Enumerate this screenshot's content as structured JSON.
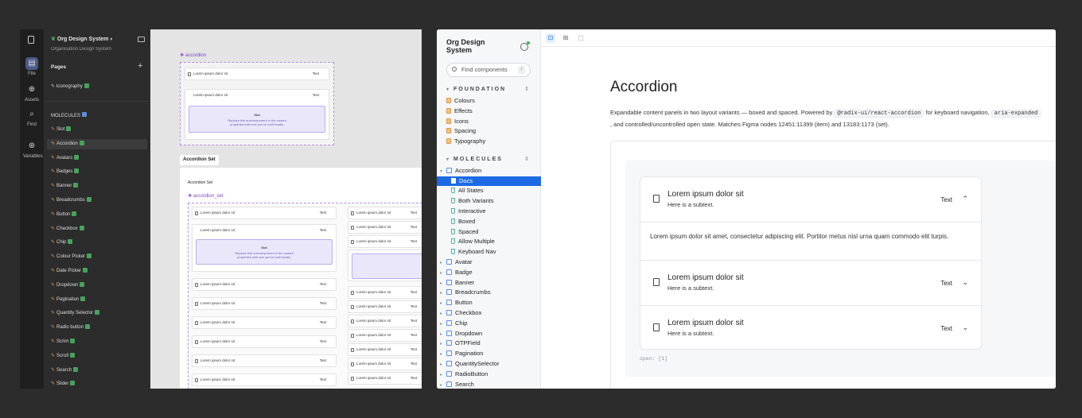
{
  "figma": {
    "rail": [
      {
        "label": "File",
        "icon": "file-icon"
      },
      {
        "label": "Assets",
        "icon": "assets-icon"
      },
      {
        "label": "Find",
        "icon": "search-icon"
      },
      {
        "label": "Variables",
        "icon": "variables-icon"
      }
    ],
    "project_title": "Org Design System",
    "project_subtitle": "Organisation Design System",
    "pages_label": "Pages",
    "pages": [
      {
        "label": "Iconography"
      }
    ],
    "molecules_header": "MOLECULES",
    "layers": [
      {
        "label": "Slot"
      },
      {
        "label": "Accordion"
      },
      {
        "label": "Avatars"
      },
      {
        "label": "Badges"
      },
      {
        "label": "Banner"
      },
      {
        "label": "Breadcrumbs"
      },
      {
        "label": "Button"
      },
      {
        "label": "Checkbox"
      },
      {
        "label": "Chip"
      },
      {
        "label": "Colour Picker"
      },
      {
        "label": "Date Picker"
      },
      {
        "label": "Dropdown"
      },
      {
        "label": "Pagination"
      },
      {
        "label": "Quantity Selector"
      },
      {
        "label": "Radio button"
      },
      {
        "label": "Scrim"
      },
      {
        "label": "Scroll"
      },
      {
        "label": "Search"
      },
      {
        "label": "Slider"
      }
    ],
    "canvas": {
      "accordion_frame_label": "accordion",
      "accordion_set_tab": "Accordion Set",
      "accordion_set_title": "Accordion Set",
      "accordion_set_frame_label": "accordion_set",
      "row_title": "Lorem ipsum dolor sit",
      "row_text": "Text",
      "slot_title": "Slot",
      "slot_desc": "Replace this subcomponent in the variant properties with one you've built locally."
    }
  },
  "storybook": {
    "title": "Org Design System",
    "search_placeholder": "Find components",
    "search_shortcut": "/",
    "foundation_header": "FOUNDATION",
    "foundation_items": [
      "Colours",
      "Effects",
      "Icons",
      "Spacing",
      "Typography"
    ],
    "molecules_header": "MOLECULES",
    "accordion_label": "Accordion",
    "accordion_stories": [
      "Docs",
      "All States",
      "Both Variants",
      "Interactive",
      "Boxed",
      "Spaced",
      "Allow Multiple",
      "Keyboard Nav"
    ],
    "components": [
      "Avatar",
      "Badge",
      "Banner",
      "Breadcrumbs",
      "Button",
      "Checkbox",
      "Chip",
      "Dropdown",
      "OTPField",
      "Pagination",
      "QuantitySelector",
      "RadioButton",
      "Search"
    ],
    "page_title": "Accordion",
    "desc_1": "Expandable content panels in two layout variants — boxed and spaced. Powered by",
    "desc_code_1": "@radix-ui/react-accordion",
    "desc_2": "for keyboard navigation,",
    "desc_code_2": "aria-expanded",
    "desc_3": ", and controlled/uncontrolled open state. Matches Figma nodes 12451:11399 (item) and 13183:1173 (set).",
    "accordion_items": [
      {
        "title": "Lorem ipsum dolor sit",
        "subtitle": "Here is a subtext.",
        "trailing": "Text",
        "open": true
      },
      {
        "title": "Lorem ipsum dolor sit",
        "subtitle": "Here is a subtext.",
        "trailing": "Text",
        "open": false
      },
      {
        "title": "Lorem ipsum dolor sit",
        "subtitle": "Here is a subtext.",
        "trailing": "Text",
        "open": false
      }
    ],
    "accordion_body": "Lorem ipsum dolor sit amet, consectetur adipiscing elit. Portitor metus nisl urna quam commodo elit turpis.",
    "open_state": "open: [1]"
  }
}
